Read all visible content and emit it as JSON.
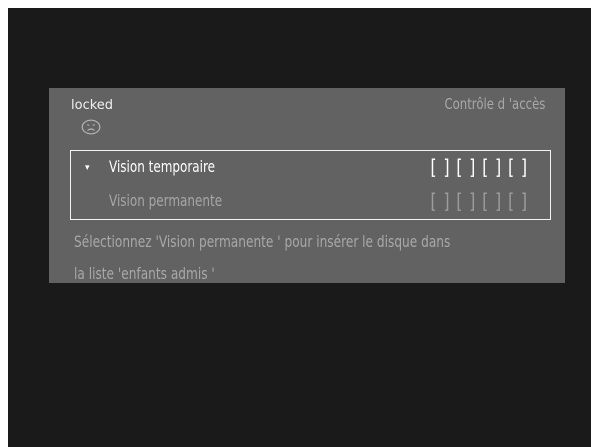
{
  "screen": {
    "status": "locked",
    "status_icon": "sad-face-icon",
    "title": "Contrôle d 'accès"
  },
  "options": [
    {
      "label": "Vision temporaire",
      "slots": "[ ] [ ] [ ] [ ]",
      "marker": "▾",
      "selected": true
    },
    {
      "label": "Vision permanente",
      "slots": "[ ] [ ] [ ] [ ]",
      "selected": false
    }
  ],
  "message": {
    "line1": "Sélectionnez 'Vision permanente ' pour insérer le disque dans",
    "line2": "la liste 'enfants admis '"
  },
  "colors": {
    "background": "#1a1a1a",
    "panel": "#626262",
    "highlight": "#ffffff",
    "dim_text": "#a8a8a8"
  }
}
